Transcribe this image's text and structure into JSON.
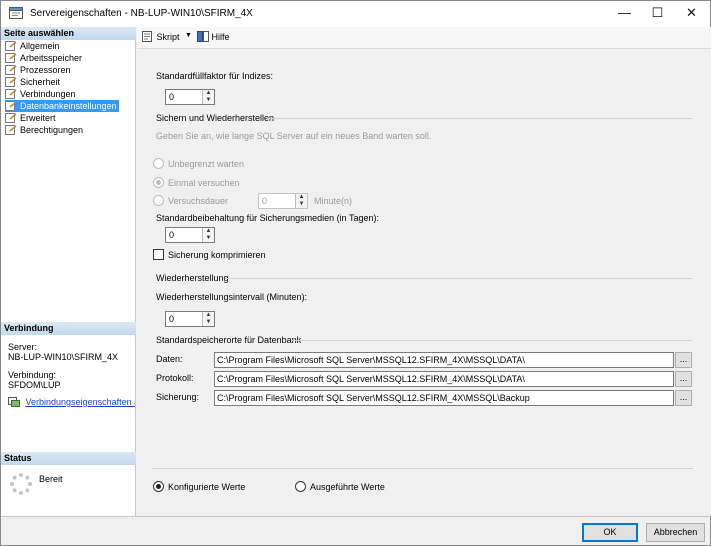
{
  "window": {
    "title": "Servereigenschaften - NB-LUP-WIN10\\SFIRM_4X",
    "minimize_glyph": "—",
    "maximize_glyph": "☐",
    "close_glyph": "✕"
  },
  "sidebar": {
    "select_page_header": "Seite auswählen",
    "items": [
      {
        "label": "Allgemein",
        "selected": false
      },
      {
        "label": "Arbeitsspeicher",
        "selected": false
      },
      {
        "label": "Prozessoren",
        "selected": false
      },
      {
        "label": "Sicherheit",
        "selected": false
      },
      {
        "label": "Verbindungen",
        "selected": false
      },
      {
        "label": "Datenbankeinstellungen",
        "selected": true
      },
      {
        "label": "Erweitert",
        "selected": false
      },
      {
        "label": "Berechtigungen",
        "selected": false
      }
    ],
    "connection": {
      "header": "Verbindung",
      "server_label": "Server:",
      "server_value": "NB-LUP-WIN10\\SFIRM_4X",
      "connection_label": "Verbindung:",
      "connection_value": "SFDOM\\LUP",
      "properties_link": "Verbindungseigenschaften anzeigen"
    },
    "status": {
      "header": "Status",
      "value": "Bereit"
    }
  },
  "toolbar": {
    "script_label": "Skript",
    "help_label": "Hilfe"
  },
  "settings": {
    "fill_factor_label": "Standardfüllfaktor für Indizes:",
    "fill_factor_value": "0",
    "backup_restore_header": "Sichern und Wiederherstellen",
    "tape_wait_hint": "Geben Sie an, wie lange SQL Server auf ein neues Band warten soll.",
    "wait_unlimited_label": "Unbegrenzt warten",
    "try_once_label": "Einmal versuchen",
    "retry_duration_label": "Versuchsdauer",
    "retry_duration_value": "0",
    "retry_unit_label": "Minute(n)",
    "retention_label": "Standardbeibehaltung für Sicherungsmedien (in Tagen):",
    "retention_value": "0",
    "compress_backup_label": "Sicherung komprimieren",
    "recovery_header": "Wiederherstellung",
    "recovery_interval_label": "Wiederherstellungsintervall (Minuten):",
    "recovery_interval_value": "0",
    "default_locations_header": "Standardspeicherorte für Datenbank",
    "data_label": "Daten:",
    "data_path": "C:\\Program Files\\Microsoft SQL Server\\MSSQL12.SFIRM_4X\\MSSQL\\DATA\\",
    "log_label": "Protokoll:",
    "log_path": "C:\\Program Files\\Microsoft SQL Server\\MSSQL12.SFIRM_4X\\MSSQL\\DATA\\",
    "backup_label": "Sicherung:",
    "backup_path": "C:\\Program Files\\Microsoft SQL Server\\MSSQL12.SFIRM_4X\\MSSQL\\Backup",
    "browse_label": "...",
    "configured_values_label": "Konfigurierte Werte",
    "running_values_label": "Ausgeführte Werte"
  },
  "footer": {
    "ok_label": "OK",
    "cancel_label": "Abbrechen"
  },
  "colors": {
    "selection": "#3399ff",
    "header_gradient": "#c3d8ec",
    "link": "#1a3fc7",
    "disabled_text": "#9a9a9a"
  }
}
